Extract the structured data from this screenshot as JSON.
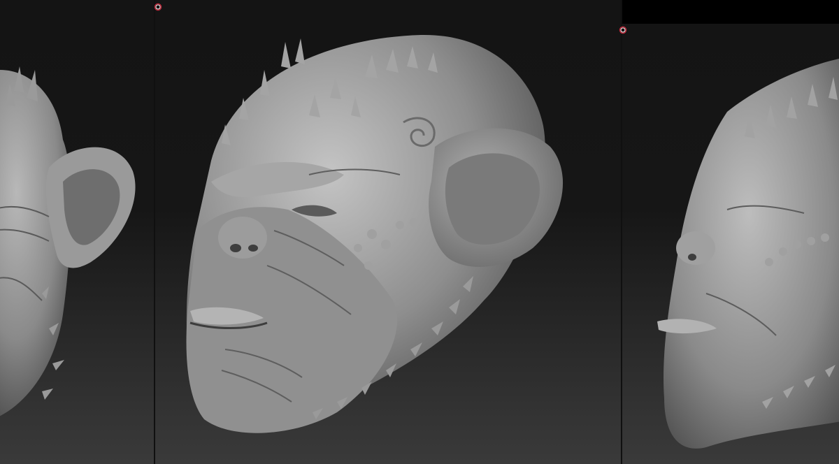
{
  "app": {
    "name": "",
    "viewports": [
      {
        "id": "left",
        "model_icon": "monkey-head-sculpt-icon"
      },
      {
        "id": "center",
        "model_icon": "monkey-head-sculpt-icon"
      },
      {
        "id": "right",
        "model_icon": "monkey-head-sculpt-icon"
      }
    ]
  },
  "colors": {
    "background_top": "#141414",
    "background_bottom": "#3a3a3a",
    "clay": "#8c8c8c",
    "clay_highlight": "#bdbdbd",
    "clay_shadow": "#4a4a4a",
    "cursor_ring": "#c0283a"
  }
}
